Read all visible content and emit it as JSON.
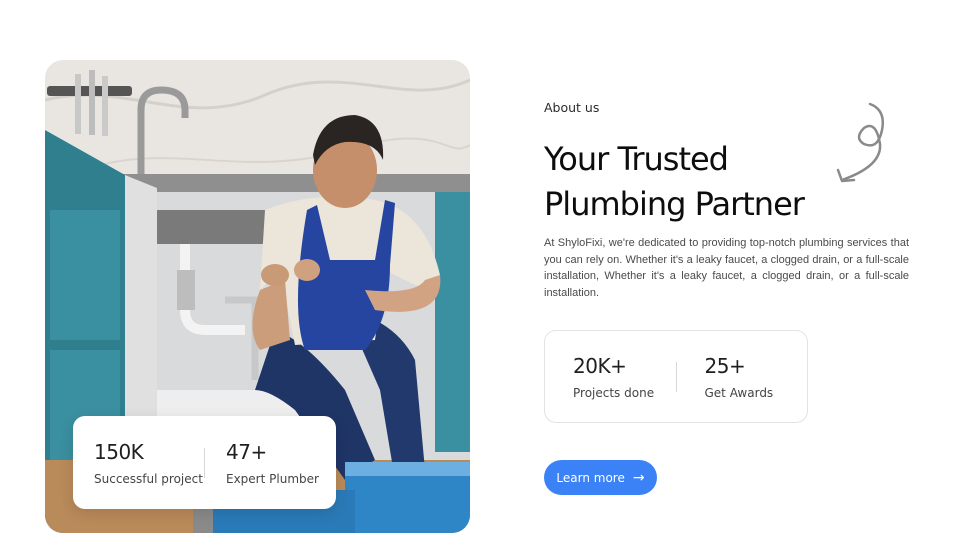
{
  "about": {
    "eyebrow": "About us",
    "heading_line1": "Your Trusted",
    "heading_line2": "Plumbing Partner",
    "body": "At ShyloFixi, we're dedicated to providing top-notch plumbing services that you can rely on. Whether it's a leaky faucet, a clogged drain, or a full-scale installation, Whether it's a leaky faucet, a clogged drain, or a full-scale installation."
  },
  "photo_stats": [
    {
      "value": "150K",
      "label": "Successful project"
    },
    {
      "value": "47+",
      "label": "Expert Plumber"
    }
  ],
  "company_stats": [
    {
      "value": "20K+",
      "label": "Projects done"
    },
    {
      "value": "25+",
      "label": "Get Awards"
    }
  ],
  "cta": {
    "label": "Learn more",
    "icon": "arrow-right-icon"
  },
  "colors": {
    "accent": "#3b82f6",
    "cabinet": "#3a8fa0"
  }
}
